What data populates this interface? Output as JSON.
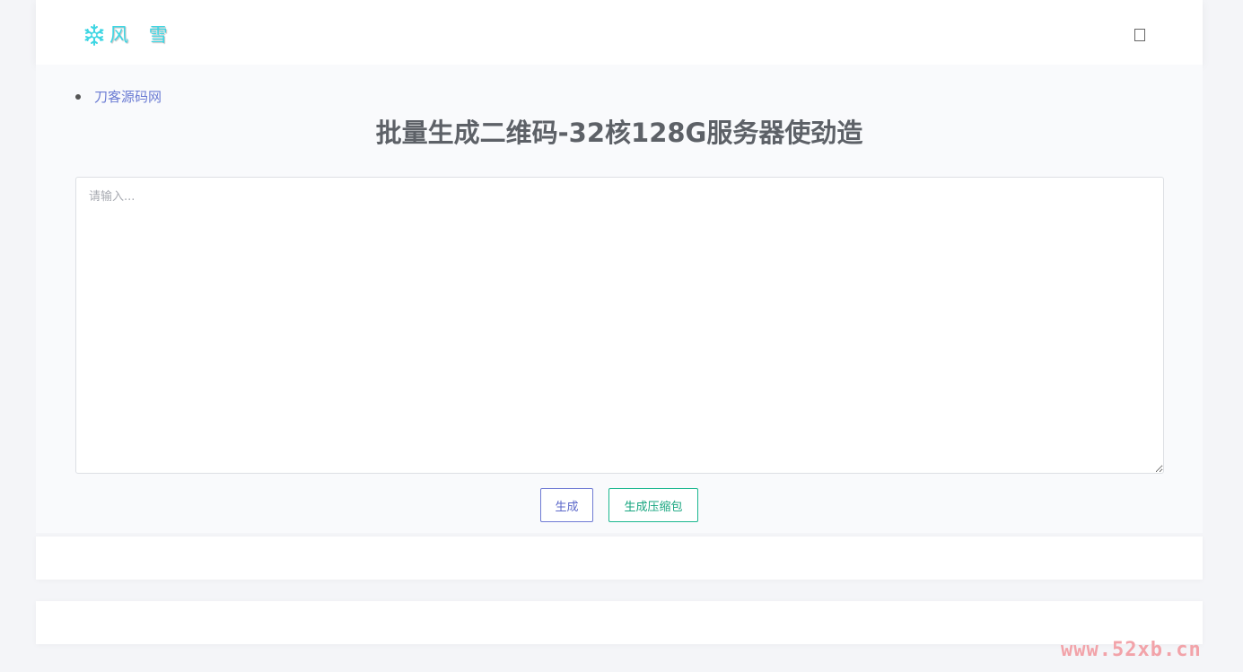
{
  "header": {
    "logo_text": "风 雪",
    "logo_icon": "snowflake-icon",
    "menu_icon": "menu-icon"
  },
  "nav": {
    "items": [
      {
        "label": "刀客源码网"
      }
    ]
  },
  "main": {
    "title": "批量生成二维码-32核128G服务器使劲造",
    "input": {
      "placeholder": "请输入...",
      "value": ""
    },
    "buttons": {
      "generate_label": "生成",
      "zip_label": "生成压缩包"
    }
  },
  "watermark": "www.52xb.cn",
  "colors": {
    "logo": "#3fd6e3",
    "link": "#6a7bd3",
    "generate_border": "#6f7bd4",
    "zip_border": "#1bb78f",
    "title": "#5d6167",
    "watermark": "#f2a3a9"
  }
}
